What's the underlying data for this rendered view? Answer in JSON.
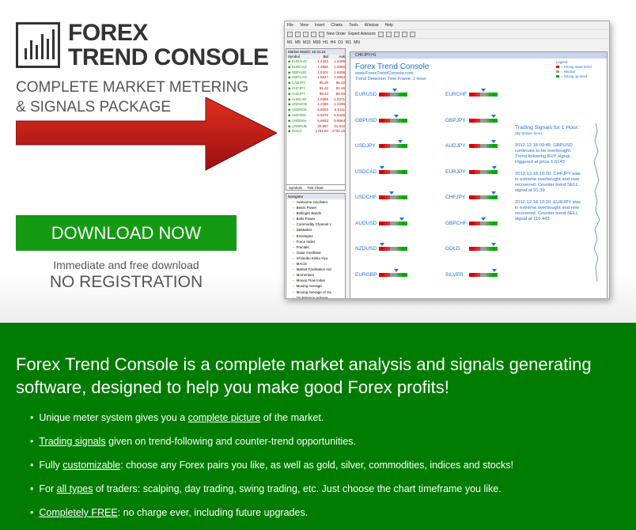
{
  "logo": {
    "line1": "FOREX",
    "line2": "TREND CONSOLE"
  },
  "tagline": "COMPLETE MARKET METERING & SIGNALS PACKAGE",
  "download": {
    "button_label": "DOWNLOAD NOW",
    "note": "Immediate and free download",
    "no_registration": "NO REGISTRATION"
  },
  "colors": {
    "download_green": "#149a13",
    "promo_green": "#007c00",
    "arrow_red": "#c8191c",
    "console_blue": "#1e6ddc"
  },
  "app": {
    "menu": [
      "File",
      "View",
      "Insert",
      "Charts",
      "Tools",
      "Window",
      "Help"
    ],
    "toolbar": {
      "new_order": "New Order",
      "expert_advisors": "Expert Advisors"
    },
    "timeframes": [
      "M1",
      "M5",
      "M15",
      "M30",
      "H1",
      "H4",
      "D1",
      "W1",
      "MN"
    ],
    "market_watch": {
      "title": "Market Watch: 10:41:24",
      "headers": [
        "Symbol",
        "Bid",
        "Ask"
      ],
      "rows": [
        [
          "EURAUD",
          "1.2493",
          "1.2495"
        ],
        [
          "EURCAD",
          "1.2950",
          "1.2956"
        ],
        [
          "GBPAUD",
          "1.5301",
          "1.5306"
        ],
        [
          "GBPCAD",
          "1.5947",
          "1.5953"
        ],
        [
          "CADJPY",
          "85.29",
          "85.32"
        ],
        [
          "CHFJPY",
          "91.42",
          "91.45"
        ],
        [
          "AUDJPY",
          "89.43",
          "89.45"
        ],
        [
          "AUDCAD",
          "1.0366",
          "1.0371"
        ],
        [
          "USDSGB",
          "1.2390",
          "1.2395"
        ],
        [
          "USDNOK",
          "5.6003",
          "5.6111"
        ],
        [
          "USDSEK",
          "6.6376",
          "6.6426"
        ],
        [
          "USDDKK",
          "5.6653",
          "5.6663"
        ],
        [
          "USDRUB",
          "30.897",
          "31.012"
        ],
        [
          "GOLD",
          "1701.63",
          "1702.15"
        ]
      ],
      "tabs": [
        "Symbols",
        "Tick Chart"
      ]
    },
    "navigator": {
      "title": "Navigator",
      "items": [
        "Awesome Oscillator",
        "Bears Power",
        "Bollinger Bands",
        "Bulls Power",
        "Commodity Channel I",
        "DeMarker",
        "Envelopes",
        "Force Index",
        "Fractals",
        "Gator Oscillator",
        "Ichimoku Kinko Hyo",
        "MACD",
        "Market Facilitation Ind",
        "Momentum",
        "Money Flow Index",
        "Moving Average",
        "Moving Average of Os",
        "On Balance Volume"
      ]
    },
    "chart": {
      "window_title": "CHFJPY,H1",
      "title": "Forex Trend Console",
      "url": "www.ForexTrendConsole.com",
      "timeframe": "Trend Detection Time Frame: 1 Hour",
      "legend": [
        "Legend",
        "= Strong down trend",
        "= Neutral",
        "= Strong up trend"
      ],
      "pairs_left": [
        {
          "name": "EURUSD",
          "level": 0.55
        },
        {
          "name": "GBPUSD",
          "level": 0.6
        },
        {
          "name": "USDJPY",
          "level": 0.75
        },
        {
          "name": "USDCAD",
          "level": 0.1
        },
        {
          "name": "USDCHF",
          "level": 0.45
        },
        {
          "name": "AUDUSD",
          "level": 0.8
        },
        {
          "name": "NZDUSD",
          "level": 0.1
        },
        {
          "name": "EURGBP",
          "level": 0.6
        }
      ],
      "pairs_right": [
        {
          "name": "EURCHF",
          "level": 0.5
        },
        {
          "name": "GBPJPY",
          "level": 0.85
        },
        {
          "name": "AUDJPY",
          "level": 0.85
        },
        {
          "name": "EURJPY",
          "level": 0.9
        },
        {
          "name": "CHFJPY",
          "level": 0.85
        },
        {
          "name": "GBPCHF",
          "level": 0.5
        },
        {
          "name": "GOLD",
          "level": 0.85
        },
        {
          "name": "SILVER",
          "level": 0.9
        }
      ],
      "signals": {
        "heading": "Trading Signals for 1 Hour:",
        "sub": "(By broker time)",
        "items": [
          "2012.12.18 09:45: GBPUSD continues to be overbought. Trend following BUY signal triggered at price 1.6145",
          "2012.12.18 10:30: CHFJPY was in extreme overbought and now recovered. Counter trend SELL signal at 91.39",
          "2012.12.18 10:30: EURJPY was in extreme overbought and now recovered. Counter trend SELL signal at 110.443"
        ]
      }
    }
  },
  "promo": {
    "lead": "Forex Trend Console is a complete market analysis and signals generating software, designed to help you make good Forex profits!",
    "features": [
      {
        "pre": "Unique meter system gives you a ",
        "link": "complete picture",
        "post": " of the market."
      },
      {
        "pre": "",
        "link": "Trading signals",
        "post": " given on trend-following and counter-trend opportunities."
      },
      {
        "pre": "Fully ",
        "link": "customizable",
        "post": ": choose any Forex pairs you like, as well as gold, silver, commodities, indices and stocks!"
      },
      {
        "pre": "For ",
        "link": "all types",
        "post": " of traders: scalping, day trading, swing trading, etc. Just choose the chart timeframe you like."
      },
      {
        "pre": "",
        "link": "Completely FREE",
        "post": ": no charge ever, including future upgrades."
      }
    ]
  }
}
